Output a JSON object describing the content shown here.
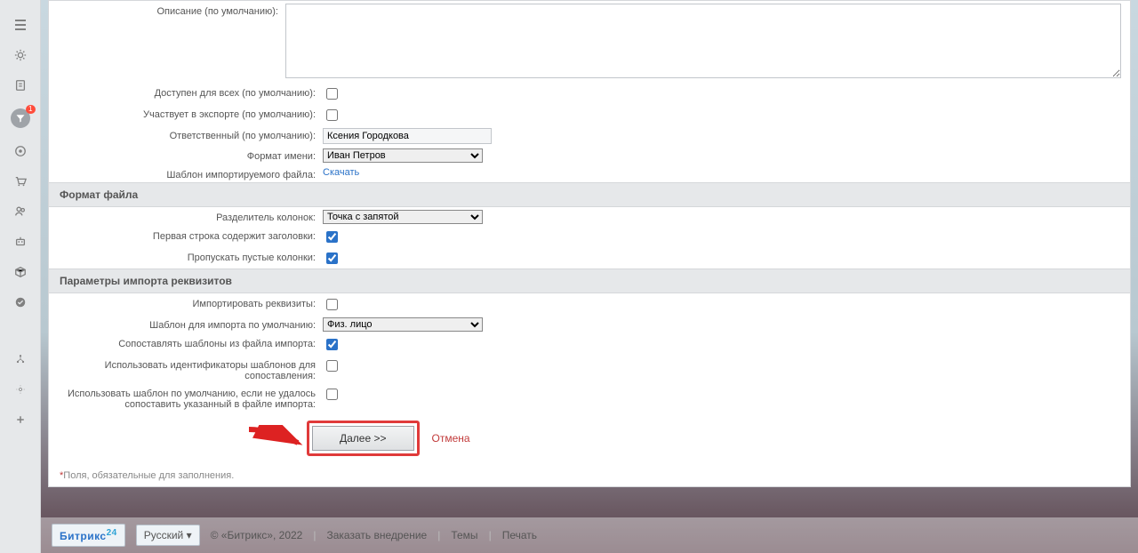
{
  "sidebar": {
    "badge": "1"
  },
  "form": {
    "desc_label": "Описание (по умолчанию):",
    "avail_label": "Доступен для всех (по умолчанию):",
    "export_label": "Участвует в экспорте (по умолчанию):",
    "resp_label": "Ответственный (по умолчанию):",
    "resp_value": "Ксения Городкова",
    "name_fmt_label": "Формат имени:",
    "name_fmt_value": "Иван Петров",
    "tpl_label": "Шаблон импортируемого файла:",
    "tpl_link": "Скачать"
  },
  "section_file": "Формат файла",
  "file": {
    "sep_label": "Разделитель колонок:",
    "sep_value": "Точка с запятой",
    "first_row_label": "Первая строка содержит заголовки:",
    "skip_empty_label": "Пропускать пустые колонки:"
  },
  "section_req": "Параметры импорта реквизитов",
  "req": {
    "import_label": "Импортировать реквизиты:",
    "tpl_def_label": "Шаблон для импорта по умолчанию:",
    "tpl_def_value": "Физ. лицо",
    "match_file_label": "Сопоставлять шаблоны из файла импорта:",
    "use_ids_label": "Использовать идентификаторы шаблонов для сопоставления:",
    "fallback_label": "Использовать шаблон по умолчанию, если не удалось сопоставить указанный в файле импорта:"
  },
  "actions": {
    "next": "Далее >>",
    "cancel": "Отмена"
  },
  "required_note": "Поля, обязательные для заполнения.",
  "footer": {
    "logo1": "Битрикс",
    "logo2": "24",
    "lang": "Русский ▾",
    "copyright": "© «Битрикс», 2022",
    "order": "Заказать внедрение",
    "themes": "Темы",
    "print": "Печать"
  }
}
